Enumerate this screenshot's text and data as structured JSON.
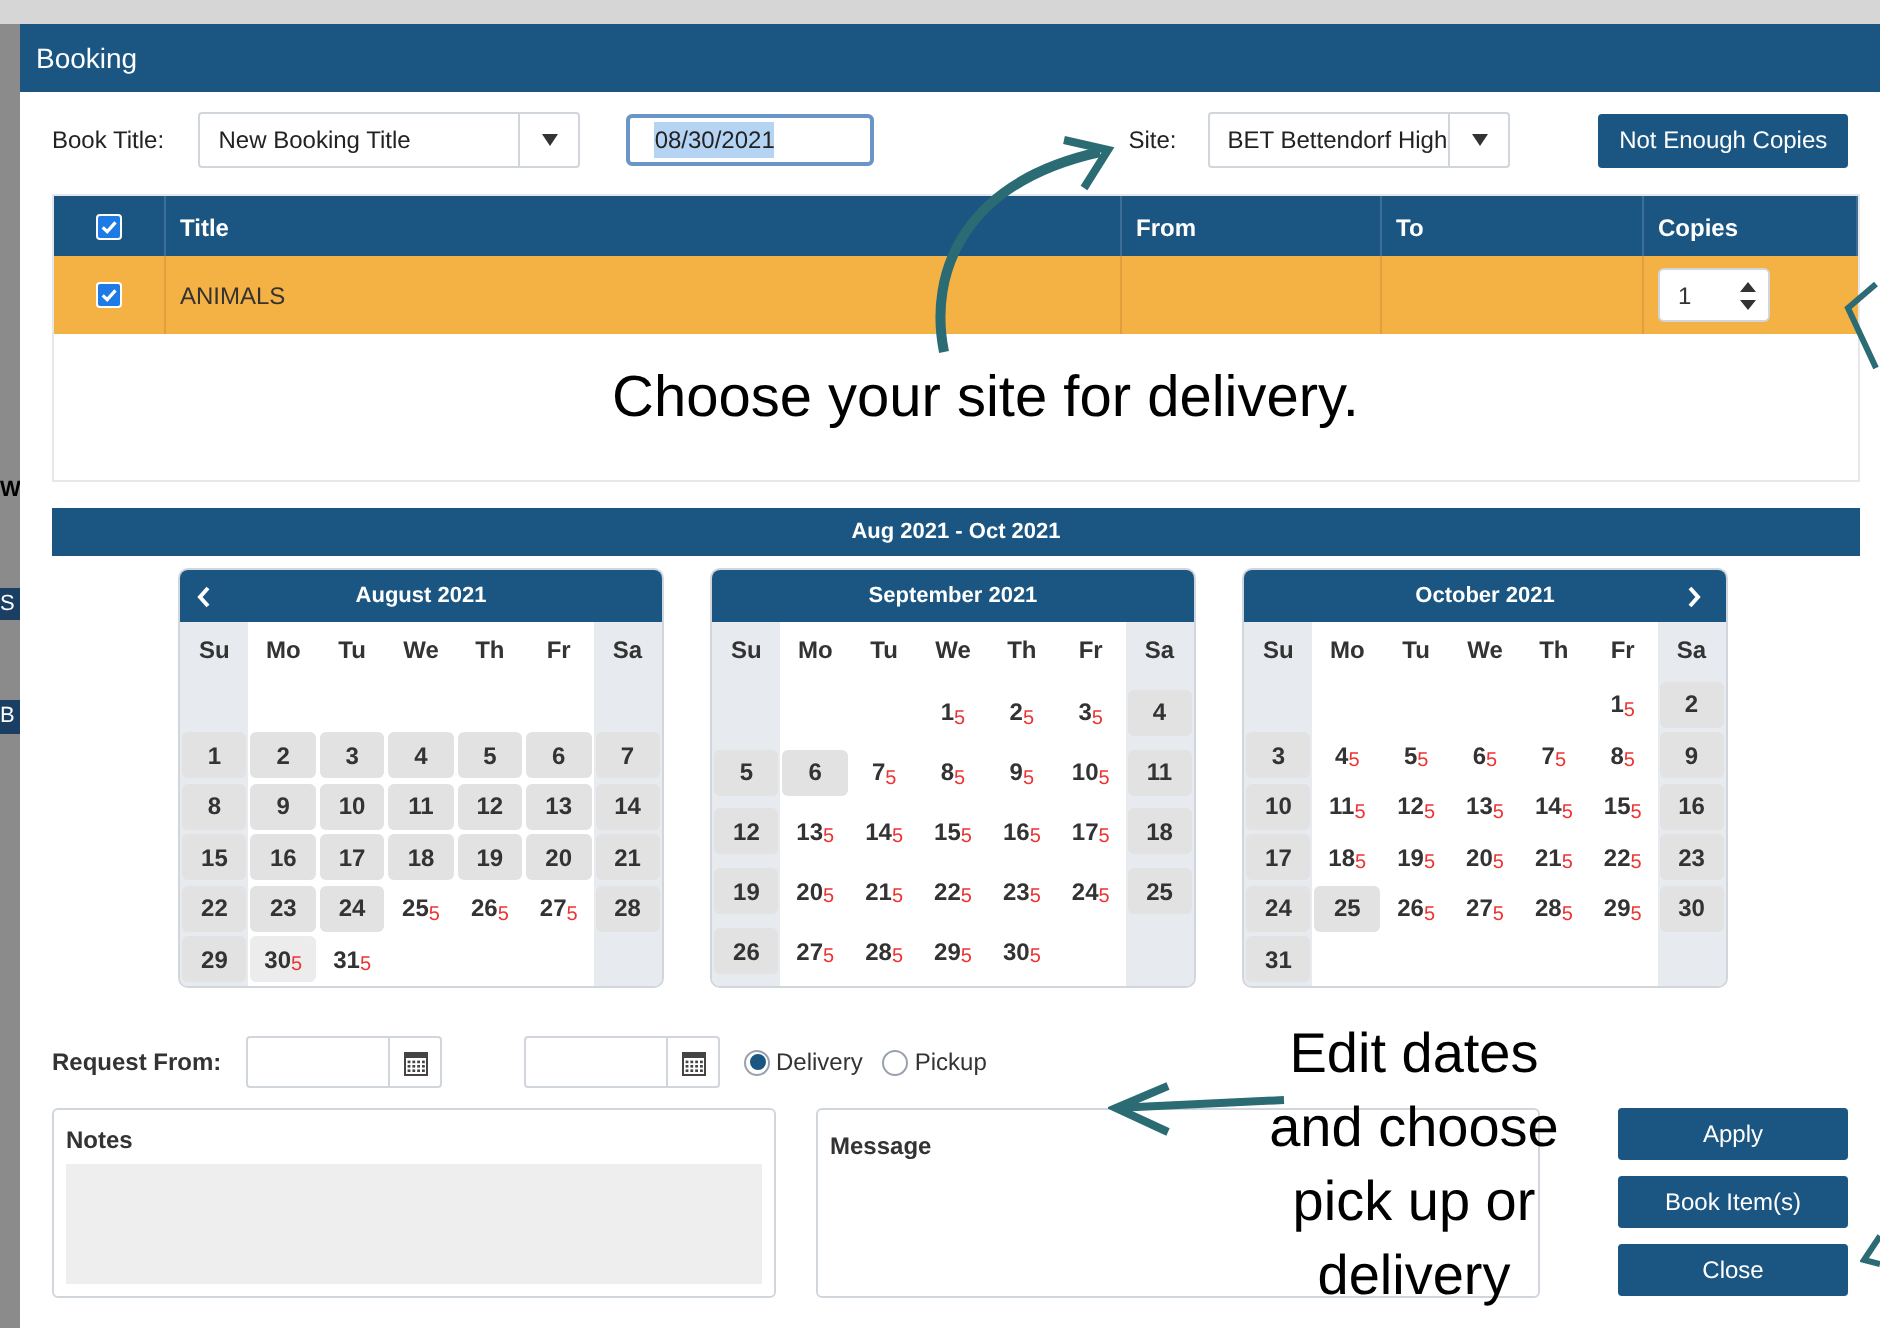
{
  "background_page": {
    "fragments": [
      "W",
      "S",
      "B"
    ]
  },
  "window": {
    "title": "Booking"
  },
  "form": {
    "book_title_label": "Book Title:",
    "book_title_value": "New Booking Title",
    "date_value": "08/30/2021",
    "site_label": "Site:",
    "site_value": "BET Bettendorf High",
    "status_button": "Not Enough Copies"
  },
  "table": {
    "header_checked": true,
    "columns": [
      "Title",
      "From",
      "To",
      "Copies"
    ],
    "rows": [
      {
        "checked": true,
        "selected": true,
        "title": "ANIMALS",
        "copies": "1"
      }
    ]
  },
  "range_title": "Aug 2021 - Oct 2021",
  "months": [
    {
      "title": "August 2021",
      "prev_arrow": true,
      "next_arrow": false,
      "weekdays": [
        "Su",
        "Mo",
        "Tu",
        "We",
        "Th",
        "Fr",
        "Sa"
      ],
      "weeks": [
        [
          {
            "kind": "empty"
          },
          {
            "kind": "empty"
          },
          {
            "kind": "empty"
          },
          {
            "kind": "empty"
          },
          {
            "kind": "empty"
          },
          {
            "kind": "empty"
          },
          {
            "kind": "empty"
          }
        ],
        [
          {
            "kind": "day",
            "day": "1",
            "shaded": true
          },
          {
            "kind": "day",
            "day": "2",
            "shaded": true
          },
          {
            "kind": "day",
            "day": "3",
            "shaded": true
          },
          {
            "kind": "day",
            "day": "4",
            "shaded": true
          },
          {
            "kind": "day",
            "day": "5",
            "shaded": true
          },
          {
            "kind": "day",
            "day": "6",
            "shaded": true
          },
          {
            "kind": "day",
            "day": "7",
            "shaded": true
          }
        ],
        [
          {
            "kind": "day",
            "day": "8",
            "shaded": true
          },
          {
            "kind": "day",
            "day": "9",
            "shaded": true
          },
          {
            "kind": "day",
            "day": "10",
            "shaded": true
          },
          {
            "kind": "day",
            "day": "11",
            "shaded": true
          },
          {
            "kind": "day",
            "day": "12",
            "shaded": true
          },
          {
            "kind": "day",
            "day": "13",
            "shaded": true
          },
          {
            "kind": "day",
            "day": "14",
            "shaded": true
          }
        ],
        [
          {
            "kind": "day",
            "day": "15",
            "shaded": true
          },
          {
            "kind": "day",
            "day": "16",
            "shaded": true
          },
          {
            "kind": "day",
            "day": "17",
            "shaded": true
          },
          {
            "kind": "day",
            "day": "18",
            "shaded": true
          },
          {
            "kind": "day",
            "day": "19",
            "shaded": true
          },
          {
            "kind": "day",
            "day": "20",
            "shaded": true
          },
          {
            "kind": "day",
            "day": "21",
            "shaded": true
          }
        ],
        [
          {
            "kind": "day",
            "day": "22",
            "shaded": true
          },
          {
            "kind": "day",
            "day": "23",
            "shaded": true
          },
          {
            "kind": "day",
            "day": "24",
            "shaded": true
          },
          {
            "kind": "day",
            "day": "25",
            "shaded": false,
            "count": "5"
          },
          {
            "kind": "day",
            "day": "26",
            "shaded": false,
            "count": "5"
          },
          {
            "kind": "day",
            "day": "27",
            "shaded": false,
            "count": "5"
          },
          {
            "kind": "day",
            "day": "28",
            "shaded": true
          }
        ],
        [
          {
            "kind": "day",
            "day": "29",
            "shaded": true
          },
          {
            "kind": "day",
            "day": "30",
            "shaded": true,
            "count": "5"
          },
          {
            "kind": "day",
            "day": "31",
            "shaded": false,
            "count": "5"
          },
          {
            "kind": "empty"
          },
          {
            "kind": "empty"
          },
          {
            "kind": "empty"
          },
          {
            "kind": "empty"
          }
        ]
      ]
    },
    {
      "title": "September 2021",
      "prev_arrow": false,
      "next_arrow": false,
      "weekdays": [
        "Su",
        "Mo",
        "Tu",
        "We",
        "Th",
        "Fr",
        "Sa"
      ],
      "weeks": [
        [
          {
            "kind": "empty"
          },
          {
            "kind": "empty"
          },
          {
            "kind": "empty"
          },
          {
            "kind": "day",
            "day": "1",
            "shaded": false,
            "count": "5"
          },
          {
            "kind": "day",
            "day": "2",
            "shaded": false,
            "count": "5"
          },
          {
            "kind": "day",
            "day": "3",
            "shaded": false,
            "count": "5"
          },
          {
            "kind": "day",
            "day": "4",
            "shaded": true
          }
        ],
        [
          {
            "kind": "day",
            "day": "5",
            "shaded": true
          },
          {
            "kind": "day",
            "day": "6",
            "shaded": true
          },
          {
            "kind": "day",
            "day": "7",
            "shaded": false,
            "count": "5"
          },
          {
            "kind": "day",
            "day": "8",
            "shaded": false,
            "count": "5"
          },
          {
            "kind": "day",
            "day": "9",
            "shaded": false,
            "count": "5"
          },
          {
            "kind": "day",
            "day": "10",
            "shaded": false,
            "count": "5"
          },
          {
            "kind": "day",
            "day": "11",
            "shaded": true
          }
        ],
        [
          {
            "kind": "day",
            "day": "12",
            "shaded": true
          },
          {
            "kind": "day",
            "day": "13",
            "shaded": false,
            "count": "5"
          },
          {
            "kind": "day",
            "day": "14",
            "shaded": false,
            "count": "5"
          },
          {
            "kind": "day",
            "day": "15",
            "shaded": false,
            "count": "5"
          },
          {
            "kind": "day",
            "day": "16",
            "shaded": false,
            "count": "5"
          },
          {
            "kind": "day",
            "day": "17",
            "shaded": false,
            "count": "5"
          },
          {
            "kind": "day",
            "day": "18",
            "shaded": true
          }
        ],
        [
          {
            "kind": "day",
            "day": "19",
            "shaded": true
          },
          {
            "kind": "day",
            "day": "20",
            "shaded": false,
            "count": "5"
          },
          {
            "kind": "day",
            "day": "21",
            "shaded": false,
            "count": "5"
          },
          {
            "kind": "day",
            "day": "22",
            "shaded": false,
            "count": "5"
          },
          {
            "kind": "day",
            "day": "23",
            "shaded": false,
            "count": "5"
          },
          {
            "kind": "day",
            "day": "24",
            "shaded": false,
            "count": "5"
          },
          {
            "kind": "day",
            "day": "25",
            "shaded": true
          }
        ],
        [
          {
            "kind": "day",
            "day": "26",
            "shaded": true
          },
          {
            "kind": "day",
            "day": "27",
            "shaded": false,
            "count": "5"
          },
          {
            "kind": "day",
            "day": "28",
            "shaded": false,
            "count": "5"
          },
          {
            "kind": "day",
            "day": "29",
            "shaded": false,
            "count": "5"
          },
          {
            "kind": "day",
            "day": "30",
            "shaded": false,
            "count": "5"
          },
          {
            "kind": "empty"
          },
          {
            "kind": "empty"
          }
        ]
      ]
    },
    {
      "title": "October 2021",
      "prev_arrow": false,
      "next_arrow": true,
      "weekdays": [
        "Su",
        "Mo",
        "Tu",
        "We",
        "Th",
        "Fr",
        "Sa"
      ],
      "weeks": [
        [
          {
            "kind": "empty"
          },
          {
            "kind": "empty"
          },
          {
            "kind": "empty"
          },
          {
            "kind": "empty"
          },
          {
            "kind": "empty"
          },
          {
            "kind": "day",
            "day": "1",
            "shaded": false,
            "count": "5"
          },
          {
            "kind": "day",
            "day": "2",
            "shaded": true
          }
        ],
        [
          {
            "kind": "day",
            "day": "3",
            "shaded": true
          },
          {
            "kind": "day",
            "day": "4",
            "shaded": false,
            "count": "5"
          },
          {
            "kind": "day",
            "day": "5",
            "shaded": false,
            "count": "5"
          },
          {
            "kind": "day",
            "day": "6",
            "shaded": false,
            "count": "5"
          },
          {
            "kind": "day",
            "day": "7",
            "shaded": false,
            "count": "5"
          },
          {
            "kind": "day",
            "day": "8",
            "shaded": false,
            "count": "5"
          },
          {
            "kind": "day",
            "day": "9",
            "shaded": true
          }
        ],
        [
          {
            "kind": "day",
            "day": "10",
            "shaded": true
          },
          {
            "kind": "day",
            "day": "11",
            "shaded": false,
            "count": "5"
          },
          {
            "kind": "day",
            "day": "12",
            "shaded": false,
            "count": "5"
          },
          {
            "kind": "day",
            "day": "13",
            "shaded": false,
            "count": "5"
          },
          {
            "kind": "day",
            "day": "14",
            "shaded": false,
            "count": "5"
          },
          {
            "kind": "day",
            "day": "15",
            "shaded": false,
            "count": "5"
          },
          {
            "kind": "day",
            "day": "16",
            "shaded": true
          }
        ],
        [
          {
            "kind": "day",
            "day": "17",
            "shaded": true
          },
          {
            "kind": "day",
            "day": "18",
            "shaded": false,
            "count": "5"
          },
          {
            "kind": "day",
            "day": "19",
            "shaded": false,
            "count": "5"
          },
          {
            "kind": "day",
            "day": "20",
            "shaded": false,
            "count": "5"
          },
          {
            "kind": "day",
            "day": "21",
            "shaded": false,
            "count": "5"
          },
          {
            "kind": "day",
            "day": "22",
            "shaded": false,
            "count": "5"
          },
          {
            "kind": "day",
            "day": "23",
            "shaded": true
          }
        ],
        [
          {
            "kind": "day",
            "day": "24",
            "shaded": true
          },
          {
            "kind": "day",
            "day": "25",
            "shaded": true
          },
          {
            "kind": "day",
            "day": "26",
            "shaded": false,
            "count": "5"
          },
          {
            "kind": "day",
            "day": "27",
            "shaded": false,
            "count": "5"
          },
          {
            "kind": "day",
            "day": "28",
            "shaded": false,
            "count": "5"
          },
          {
            "kind": "day",
            "day": "29",
            "shaded": false,
            "count": "5"
          },
          {
            "kind": "day",
            "day": "30",
            "shaded": true
          }
        ],
        [
          {
            "kind": "day",
            "day": "31",
            "shaded": true
          },
          {
            "kind": "empty"
          },
          {
            "kind": "empty"
          },
          {
            "kind": "empty"
          },
          {
            "kind": "empty"
          },
          {
            "kind": "empty"
          },
          {
            "kind": "empty"
          }
        ]
      ]
    }
  ],
  "request": {
    "label": "Request From:",
    "options": [
      {
        "label": "Delivery",
        "selected": true
      },
      {
        "label": "Pickup",
        "selected": false
      }
    ]
  },
  "notes_label": "Notes",
  "message_label": "Message",
  "buttons": [
    "Apply",
    "Book Item(s)",
    "Close"
  ],
  "annotations": [
    {
      "kind": "site",
      "text": "Choose your site for delivery."
    },
    {
      "kind": "dates",
      "text": "Edit dates and choose pick up or delivery"
    }
  ]
}
